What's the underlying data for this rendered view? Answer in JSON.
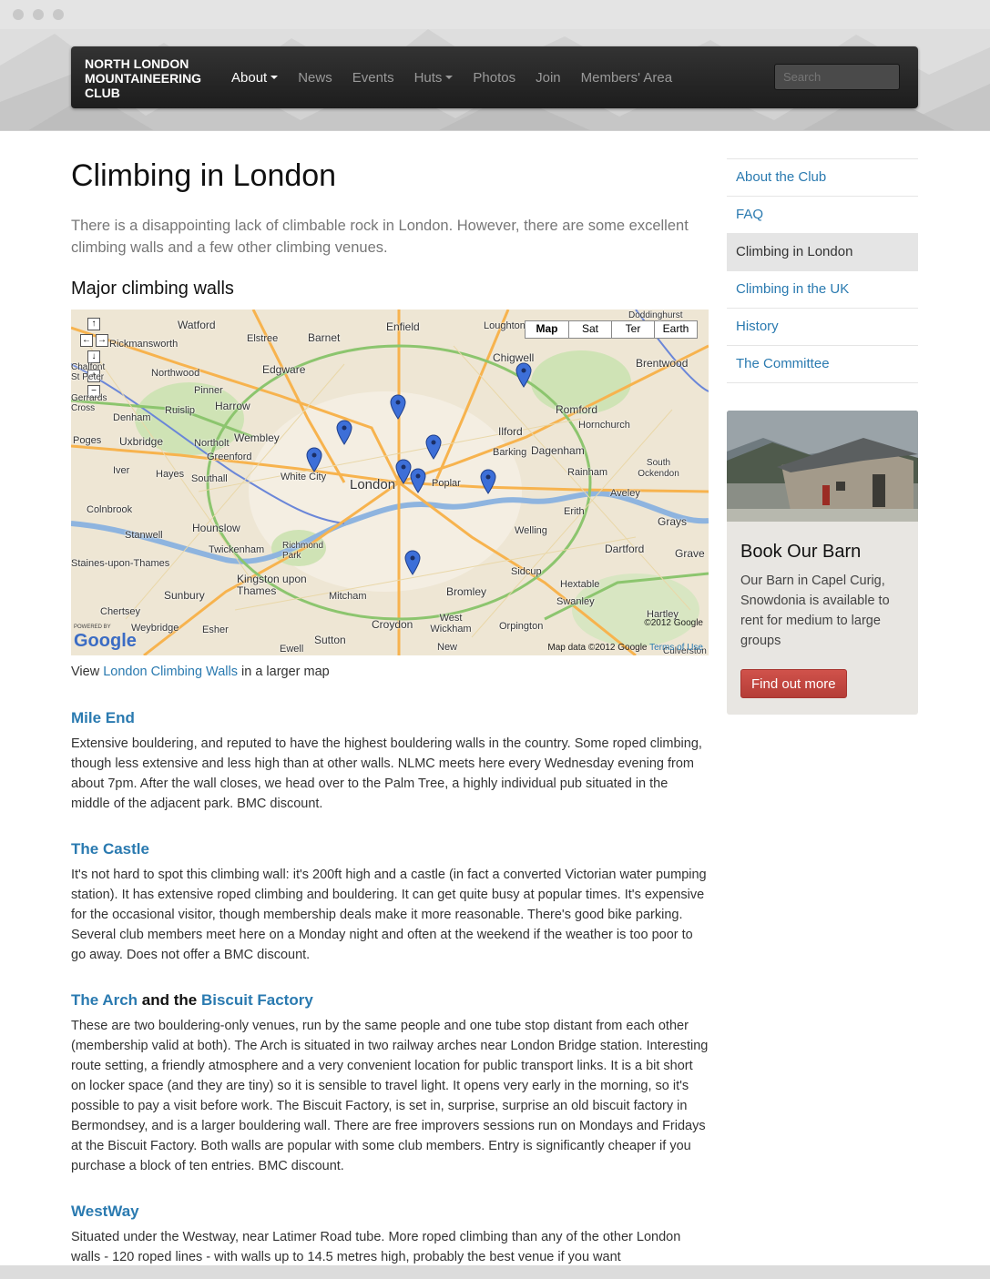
{
  "nav": {
    "brand_lines": [
      "NORTH LONDON",
      "MOUNTAINEERING",
      "CLUB"
    ],
    "items": [
      {
        "label": "About",
        "active": true,
        "dropdown": true
      },
      {
        "label": "News"
      },
      {
        "label": "Events"
      },
      {
        "label": "Huts",
        "dropdown": true
      },
      {
        "label": "Photos"
      },
      {
        "label": "Join"
      },
      {
        "label": "Members' Area"
      }
    ],
    "search_placeholder": "Search"
  },
  "page": {
    "title": "Climbing in London",
    "lead": "There is a disappointing lack of climbable rock in London. However, there are some excellent climbing walls and a few other climbing venues.",
    "walls_heading": "Major climbing walls",
    "map_caption": {
      "before": "View",
      "link": "London Climbing Walls",
      "after": "in a larger map"
    }
  },
  "map": {
    "types": [
      "Map",
      "Sat",
      "Ter",
      "Earth"
    ],
    "controls": [
      "↑",
      "←",
      "→",
      "↓",
      "+",
      "−"
    ],
    "places": [
      "Watford",
      "Enfield",
      "Loughton",
      "Barnet",
      "Elstree",
      "Chigwell",
      "Brentwood",
      "Rickmansworth",
      "Northwood",
      "Edgware",
      "Pinner",
      "Ruislip",
      "Harrow",
      "Romford",
      "Hornchurch",
      "Denham",
      "Wembley",
      "Ilford",
      "Uxbridge",
      "Northolt",
      "Barking",
      "Dagenham",
      "Greenford",
      "Poges",
      "Iver",
      "Hayes",
      "Southall",
      "White City",
      "London",
      "Poplar",
      "Rainham",
      "South Ockendon",
      "Aveley",
      "Colnbrook",
      "Erith",
      "Grays",
      "Hounslow",
      "Stanwell",
      "Welling",
      "Twickenham",
      "Richmond Park",
      "Dartford",
      "Kingston upon Thames",
      "Sidcup",
      "Hextable",
      "Swanley",
      "Sunbury",
      "Mitcham",
      "Bromley",
      "Chertsey",
      "Weybridge",
      "Esher",
      "Croydon",
      "West Wickham",
      "Orpington",
      "Hartley",
      "Sutton",
      "Ewell",
      "New",
      "Chalfont St Peter",
      "Gerrards Cross",
      "Staines-upon-Thames",
      "Grave",
      "Doddinghurst",
      "Culverston"
    ],
    "google_logo": "Google",
    "powered_by": "POWERED BY",
    "copyright_top": "©2012 Google",
    "copyright": "Map data ©2012 Google",
    "terms": "Terms of Use"
  },
  "venues": [
    {
      "name": "Mile End",
      "text": "Extensive bouldering, and reputed to have the highest bouldering walls in the country.  Some roped climbing, though less extensive and less high than at other walls. NLMC meets here every Wednesday evening from about 7pm. After the wall closes, we head over to the Palm Tree, a highly individual pub situated in the middle of the adjacent park. BMC discount."
    },
    {
      "name": "The Castle",
      "text": "It's not hard to spot this climbing wall: it's 200ft high and a castle (in fact a converted Victorian water pumping station).  It has extensive roped climbing and bouldering. It can get quite busy at popular times. It's expensive for the occasional visitor, though membership deals make it more reasonable. There's good bike parking. Several club members meet here on a Monday night and often at the weekend if the weather is too poor to go away. Does not offer a BMC discount."
    },
    {
      "name_parts": [
        "The Arch",
        "and the",
        "Biscuit Factory"
      ],
      "text": "These are two bouldering-only venues, run by the same people and one tube stop distant from each other (membership valid at both). The Arch is situated in two railway arches near London Bridge station. Interesting route setting, a friendly atmosphere and a very convenient location for public transport links. It is a bit short on locker space (and they are tiny) so it is sensible to travel light. It opens very early in the morning, so it's possible to pay a visit before work. The Biscuit Factory, is set in, surprise, surprise an old biscuit factory in Bermondsey, and is a larger bouldering wall. There are free improvers sessions run on Mondays and Fridays at the Biscuit Factory. Both walls are popular with some club members. Entry is significantly cheaper if you purchase a block of ten entries. BMC discount."
    },
    {
      "name": "WestWay",
      "text": "Situated under the Westway, near Latimer Road tube.  More roped climbing than any of the other London walls - 120 roped lines - with walls up to 14.5 metres high, probably the best venue if you want"
    }
  ],
  "sidebar": {
    "items": [
      {
        "label": "About the Club"
      },
      {
        "label": "FAQ"
      },
      {
        "label": "Climbing in London",
        "active": true
      },
      {
        "label": "Climbing in the UK"
      },
      {
        "label": "History"
      },
      {
        "label": "The Committee"
      }
    ],
    "barn": {
      "title": "Book Our Barn",
      "text": "Our Barn in Capel Curig, Snowdonia is available to rent for medium to large groups",
      "button": "Find out more"
    }
  },
  "colors": {
    "navbar": "#222222",
    "link": "#2a7ab0",
    "button": "#c0443e",
    "sidebar_active": "#e5e5e5",
    "pin": "#3d6fd8"
  }
}
